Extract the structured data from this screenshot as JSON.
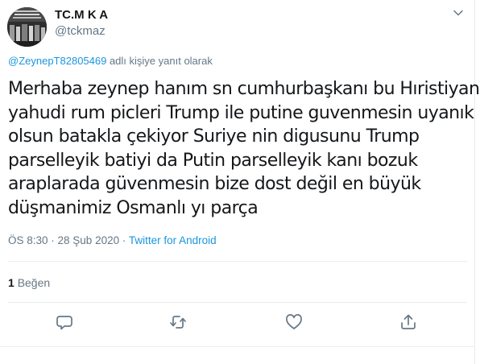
{
  "user": {
    "display_name": "TC.M K A",
    "handle": "@tckmaz"
  },
  "reply_context": {
    "mention": "@ZeynepT82805469",
    "suffix": " adlı kişiye yanıt olarak"
  },
  "tweet": {
    "lines": [
      "Merhaba zeynep hanım sn cumhurbaşkanı bu Hıristiyan",
      "yahudi rum picleri Trump ile putine guvenmesin uyanık",
      "olsun batakla çekiyor Suriye nin digusunu Trump",
      "parselleyik batiyi da Putin parselleyik kanı bozuk",
      "araplarada güvenmesin bize dost değil en büyük",
      "düşmanimiz Osmanlı yı parça"
    ],
    "time": "ÖS 8:30",
    "separator": " · ",
    "date": "28 Şub 2020",
    "source": "Twitter for Android"
  },
  "stats": {
    "likes_count": "1",
    "likes_label": "Beğen"
  },
  "actions": [
    {
      "name": "reply-icon"
    },
    {
      "name": "retweet-icon"
    },
    {
      "name": "like-icon"
    },
    {
      "name": "share-icon"
    }
  ],
  "colors": {
    "text": "#14171a",
    "secondary": "#657786",
    "link": "#1b95e0",
    "border": "#e6ecf0"
  }
}
